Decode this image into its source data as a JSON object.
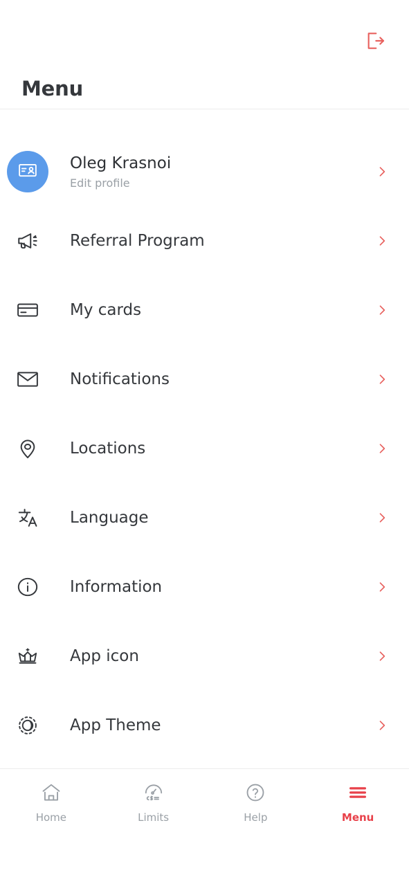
{
  "header": {
    "title": "Menu",
    "logout_icon": "logout-icon"
  },
  "theme": {
    "accent_red": "#e8414a",
    "chevron_red": "#e8615e",
    "avatar_blue": "#5b9bea",
    "icon_dark": "#35383c",
    "text_muted": "#9aa0a6",
    "divider": "#ececec",
    "background": "#ffffff"
  },
  "profile": {
    "name": "Oleg Krasnoi",
    "subtitle": "Edit profile",
    "avatar_icon": "id-card-icon",
    "chevron_icon": "chevron-right-icon"
  },
  "menu": {
    "items": [
      {
        "label": "Referral Program",
        "icon": "megaphone-icon"
      },
      {
        "label": "My cards",
        "icon": "credit-card-icon"
      },
      {
        "label": "Notifications",
        "icon": "envelope-icon"
      },
      {
        "label": "Locations",
        "icon": "map-pin-icon"
      },
      {
        "label": "Language",
        "icon": "translate-icon"
      },
      {
        "label": "Information",
        "icon": "info-circle-icon"
      },
      {
        "label": "App icon",
        "icon": "crown-icon"
      },
      {
        "label": "App Theme",
        "icon": "theme-contrast-icon"
      }
    ]
  },
  "bottom_nav": {
    "items": [
      {
        "label": "Home",
        "icon": "home-icon",
        "active": false
      },
      {
        "label": "Limits",
        "icon": "gauge-currency-icon",
        "active": false
      },
      {
        "label": "Help",
        "icon": "question-circle-icon",
        "active": false
      },
      {
        "label": "Menu",
        "icon": "hamburger-icon",
        "active": true
      }
    ]
  }
}
